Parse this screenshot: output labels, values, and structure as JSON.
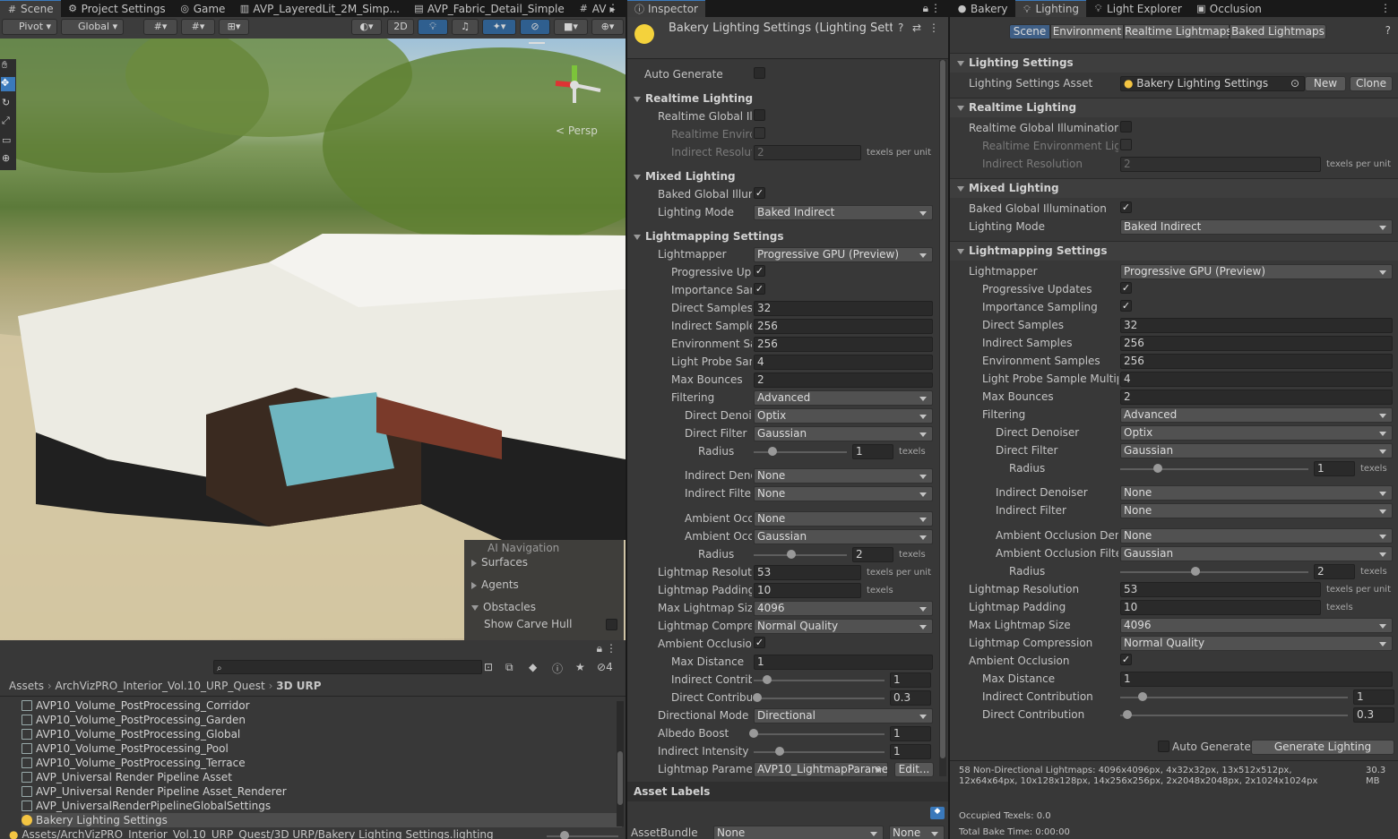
{
  "top_tabs": {
    "left": [
      {
        "label": "Scene",
        "icon": "grid-icon"
      },
      {
        "label": "Project Settings",
        "icon": "gear-icon"
      },
      {
        "label": "Game",
        "icon": "gamepad-icon"
      },
      {
        "label": "AVP_LayeredLit_2M_Simp...",
        "icon": "shader-icon"
      },
      {
        "label": "AVP_Fabric_Detail_Simple",
        "icon": "material-icon"
      },
      {
        "label": "AV",
        "icon": "shader-icon"
      }
    ],
    "inspector": {
      "label": "Inspector"
    },
    "right": [
      {
        "label": "Bakery"
      },
      {
        "label": "Lighting"
      },
      {
        "label": "Light Explorer"
      },
      {
        "label": "Occlusion"
      }
    ]
  },
  "scene_toolbar": {
    "pivot": "Pivot",
    "global": "Global",
    "mode_2d": "2D"
  },
  "scene_view": {
    "persp": "< Persp",
    "overlay": {
      "title": "AI Navigation",
      "items": [
        "Surfaces",
        "Agents",
        "Obstacles"
      ],
      "toggle_label": "Show Carve Hull"
    }
  },
  "project": {
    "breadcrumb": [
      "Assets",
      "ArchVizPRO_Interior_Vol.10_URP_Quest",
      "3D URP"
    ],
    "hidden_count": "4",
    "files": [
      "AVP10_Volume_PostProcessing_Corridor",
      "AVP10_Volume_PostProcessing_Garden",
      "AVP10_Volume_PostProcessing_Global",
      "AVP10_Volume_PostProcessing_Pool",
      "AVP10_Volume_PostProcessing_Terrace",
      "AVP_Universal Render Pipeline Asset",
      "AVP_Universal Render Pipeline Asset_Renderer",
      "AVP_UniversalRenderPipelineGlobalSettings",
      "Bakery Lighting Settings"
    ],
    "footer_path": "Assets/ArchVizPRO_Interior_Vol.10_URP_Quest/3D URP/Bakery Lighting Settings.lighting"
  },
  "inspector": {
    "title": "Bakery Lighting Settings (Lighting Settir",
    "auto_generate": "Auto Generate",
    "realtime_header": "Realtime Lighting",
    "realtime_gi": "Realtime Global Illu",
    "realtime_env": "Realtime Enviror",
    "indirect_res": "Indirect Resoluti",
    "indirect_res_value": "2",
    "texels_per_unit": "texels per unit",
    "texels": "texels",
    "mixed_header": "Mixed Lighting",
    "baked_gi": "Baked Global Illum",
    "lighting_mode": "Lighting Mode",
    "lighting_mode_value": "Baked Indirect",
    "lm_header": "Lightmapping Settings",
    "lightmapper": "Lightmapper",
    "lightmapper_value": "Progressive GPU (Preview)",
    "prog_updates": "Progressive Upc",
    "imp_sampling": "Importance Sam",
    "direct_samples": "Direct Samples",
    "direct_samples_value": "32",
    "indirect_samples": "Indirect Sample:",
    "indirect_samples_value": "256",
    "env_samples": "Environment Sa",
    "env_samples_value": "256",
    "lp_samples": "Light Probe Sam",
    "lp_samples_value": "4",
    "max_bounces": "Max Bounces",
    "max_bounces_value": "2",
    "filtering": "Filtering",
    "filtering_value": "Advanced",
    "direct_denoiser": "Direct Denoi:",
    "direct_denoiser_value": "Optix",
    "direct_filter": "Direct Filter",
    "direct_filter_value": "Gaussian",
    "radius": "Radius",
    "radius1_value": "1",
    "indirect_denoiser": "Indirect Deno",
    "indirect_denoiser_value": "None",
    "indirect_filter": "Indirect Filter",
    "indirect_filter_value": "None",
    "ao_denoiser": "Ambient Occl",
    "ao_denoiser_value": "None",
    "ao_filter": "Ambient Occl",
    "ao_filter_value": "Gaussian",
    "radius2_value": "2",
    "lm_resolution": "Lightmap Resolutic",
    "lm_resolution_value": "53",
    "lm_padding": "Lightmap Padding",
    "lm_padding_value": "10",
    "max_lm_size": "Max Lightmap Size",
    "max_lm_size_value": "4096",
    "lm_compression": "Lightmap Compres",
    "lm_compression_value": "Normal Quality",
    "ambient_occlusion": "Ambient Occlusion",
    "max_distance": "Max Distance",
    "max_distance_value": "1",
    "indirect_contrib": "Indirect Contribu",
    "indirect_contrib_value": "1",
    "direct_contrib": "Direct Contribut",
    "direct_contrib_value": "0.3",
    "dir_mode": "Directional Mode",
    "dir_mode_value": "Directional",
    "albedo_boost": "Albedo Boost",
    "albedo_boost_value": "1",
    "indirect_intensity": "Indirect Intensity",
    "indirect_intensity_value": "1",
    "lm_params": "Lightmap Paramet",
    "lm_params_value": "AVP10_LightmapParame",
    "edit": "Edit...",
    "asset_labels": "Asset Labels",
    "asset_bundle": "AssetBundle",
    "asset_bundle_value": "None",
    "asset_bundle_variant": "None",
    "sliders": {
      "radius1": 0.2,
      "radius2": 0.4,
      "indirect_contrib": 0.1,
      "direct_contrib": 0.03,
      "albedo_boost": 0.0,
      "indirect_intensity": 0.2
    }
  },
  "lighting": {
    "tabs": [
      "Scene",
      "Environment",
      "Realtime Lightmaps",
      "Baked Lightmaps"
    ],
    "settings_header": "Lighting Settings",
    "settings_asset": "Lighting Settings Asset",
    "settings_asset_value": "Bakery Lighting Settings",
    "new": "New",
    "clone": "Clone",
    "realtime_header": "Realtime Lighting",
    "realtime_gi": "Realtime Global Illumination",
    "realtime_env": "Realtime Environment Light",
    "indirect_res": "Indirect Resolution",
    "indirect_res_value": "2",
    "texels_per_unit": "texels per unit",
    "texels": "texels",
    "mixed_header": "Mixed Lighting",
    "baked_gi": "Baked Global Illumination",
    "lighting_mode": "Lighting Mode",
    "lighting_mode_value": "Baked Indirect",
    "lm_header": "Lightmapping Settings",
    "lightmapper": "Lightmapper",
    "lightmapper_value": "Progressive GPU (Preview)",
    "prog_updates": "Progressive Updates",
    "imp_sampling": "Importance Sampling",
    "direct_samples": "Direct Samples",
    "direct_samples_value": "32",
    "indirect_samples": "Indirect Samples",
    "indirect_samples_value": "256",
    "env_samples": "Environment Samples",
    "env_samples_value": "256",
    "lp_samples": "Light Probe Sample Multipli",
    "lp_samples_value": "4",
    "max_bounces": "Max Bounces",
    "max_bounces_value": "2",
    "filtering": "Filtering",
    "filtering_value": "Advanced",
    "direct_denoiser": "Direct Denoiser",
    "direct_denoiser_value": "Optix",
    "direct_filter": "Direct Filter",
    "direct_filter_value": "Gaussian",
    "radius": "Radius",
    "radius1_value": "1",
    "indirect_denoiser": "Indirect Denoiser",
    "indirect_denoiser_value": "None",
    "indirect_filter": "Indirect Filter",
    "indirect_filter_value": "None",
    "ao_denoiser": "Ambient Occlusion Deno",
    "ao_denoiser_value": "None",
    "ao_filter": "Ambient Occlusion Filter",
    "ao_filter_value": "Gaussian",
    "radius2_value": "2",
    "lm_resolution": "Lightmap Resolution",
    "lm_resolution_value": "53",
    "lm_padding": "Lightmap Padding",
    "lm_padding_value": "10",
    "max_lm_size": "Max Lightmap Size",
    "max_lm_size_value": "4096",
    "lm_compression": "Lightmap Compression",
    "lm_compression_value": "Normal Quality",
    "ambient_occlusion": "Ambient Occlusion",
    "max_distance": "Max Distance",
    "max_distance_value": "1",
    "indirect_contrib": "Indirect Contribution",
    "indirect_contrib_value": "1",
    "direct_contrib": "Direct Contribution",
    "direct_contrib_value": "0.3",
    "auto_generate": "Auto Generate",
    "generate": "Generate Lighting",
    "stats": "58 Non-Directional Lightmaps: 4096x4096px, 4x32x32px, 13x512x512px, 12x64x64px, 10x128x128px, 14x256x256px, 2x2048x2048px, 2x1024x1024px",
    "size": "30.3 MB",
    "occupied": "Occupied Texels: 0.0",
    "bake_time": "Total Bake Time: 0:00:00",
    "sliders": {
      "radius1": 0.2,
      "radius2": 0.4,
      "indirect_contrib": 0.1,
      "direct_contrib": 0.03
    }
  }
}
